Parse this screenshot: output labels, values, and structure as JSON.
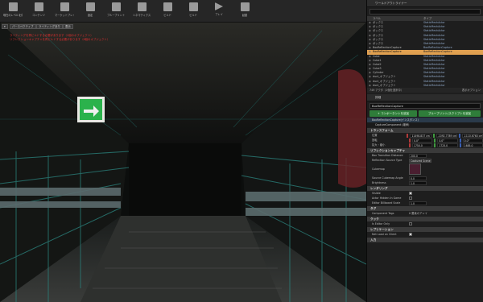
{
  "toolbar": {
    "buttons": [
      "現在のレベルを保存",
      "コンテンツ",
      "マーケットプレイス",
      "設定",
      "ブループリント",
      "シネマティクス",
      "ビルド",
      "ビルド",
      "プレイ",
      "起動"
    ]
  },
  "viewport": {
    "perspective_label": "パースペクティブ",
    "lit_label": "ライティングあり",
    "show_label": "表示",
    "warning_lines": [
      "ライティングを再ビルドする必要があります（1個のオブジェクト）",
      "リフレクションキャプチャを再ビルドする必要があります（6個のオブジェクト）"
    ],
    "exit_sign_text": "図"
  },
  "outliner": {
    "tab_label": "ワールドアウトライナー",
    "col_label": "ラベル",
    "col_type": "タイプ",
    "rows": [
      {
        "name": "ボックス",
        "type": "StaticMeshActor"
      },
      {
        "name": "ボックス",
        "type": "StaticMeshActor"
      },
      {
        "name": "ボックス",
        "type": "StaticMeshActor"
      },
      {
        "name": "ボックス",
        "type": "StaticMeshActor"
      },
      {
        "name": "ボックス",
        "type": "StaticMeshActor"
      },
      {
        "name": "ボックス",
        "type": "StaticMeshActor"
      },
      {
        "name": "BoxReflectionCapture",
        "type": "BoxReflectionCapture"
      },
      {
        "name": "BoxReflectionCapture",
        "type": "BoxReflectionCapture"
      },
      {
        "name": "Cube",
        "type": "StaticMeshActor"
      },
      {
        "name": "Cube1",
        "type": "StaticMeshActor"
      },
      {
        "name": "Cube2",
        "type": "StaticMeshActor"
      },
      {
        "name": "Cube3",
        "type": "StaticMeshActor"
      },
      {
        "name": "Cylinder",
        "type": "StaticMeshActor"
      },
      {
        "name": "duct_オブジェクト",
        "type": "StaticMeshActor"
      },
      {
        "name": "duct_オブジェクト",
        "type": "StaticMeshActor"
      },
      {
        "name": "duct_オブジェクト",
        "type": "StaticMeshActor"
      }
    ],
    "selected_index": 7,
    "footer_count": "749 アクタ（1個を選択中）",
    "footer_view": "表示オプション"
  },
  "details": {
    "tab_label": "詳細",
    "actor_name": "BoxReflectionCapture",
    "add_component": "+ コンポーネントを追加",
    "blueprint_button": "ブループリント/スクリプトを追加",
    "component_self": "BoxReflectionCapture(インスタンス)",
    "component_child": "CaptureComponent (継承)",
    "sections": {
      "transform": "トランスフォーム",
      "reflection": "リフレクションキャプチャ",
      "rendering": "レンダリング",
      "tags": "タグ",
      "cooking": "クック",
      "replication": "レプリケーション",
      "input": "入力"
    },
    "transform": {
      "location_label": "位置",
      "rotation_label": "回転",
      "scale_label": "拡大・縮小",
      "location": [
        "11498.837 cm",
        "-1092.7789 cm",
        "-1110.6760 cm"
      ],
      "rotation": [
        "0.0°",
        "0.0°",
        "0.0°"
      ],
      "scale": [
        "1750.0",
        "1725.0",
        "1685.0"
      ]
    },
    "reflection": {
      "box_transition_label": "Box Transition Distance",
      "box_transition_value": "200.0",
      "source_type_label": "Reflection Source Type",
      "source_type_value": "Captured Scene",
      "cubemap_label": "Cubemap",
      "cubemap_angle_label": "Source Cubemap Angle",
      "cubemap_angle_value": "0.0",
      "brightness_label": "Brightness",
      "brightness_value": "1.0"
    },
    "rendering": {
      "visible_label": "Visible",
      "hidden_label": "Actor Hidden In Game",
      "billboard_label": "Editor Billboard Scale",
      "billboard_value": "1.0"
    },
    "tags": {
      "component_tags_label": "Component Tags",
      "component_tags_value": "0 要素のアレイ"
    },
    "cooking": {
      "editor_only_label": "Is Editor Only"
    },
    "replication": {
      "net_load_label": "Net Load on Client"
    }
  },
  "colors": {
    "accent_selected": "#e0a050",
    "green_button": "#2f7d3a",
    "axis_x": "#b33a3a",
    "axis_y": "#3f9a3f",
    "axis_z": "#3a5fb3",
    "exit_sign": "#2bb24c"
  }
}
